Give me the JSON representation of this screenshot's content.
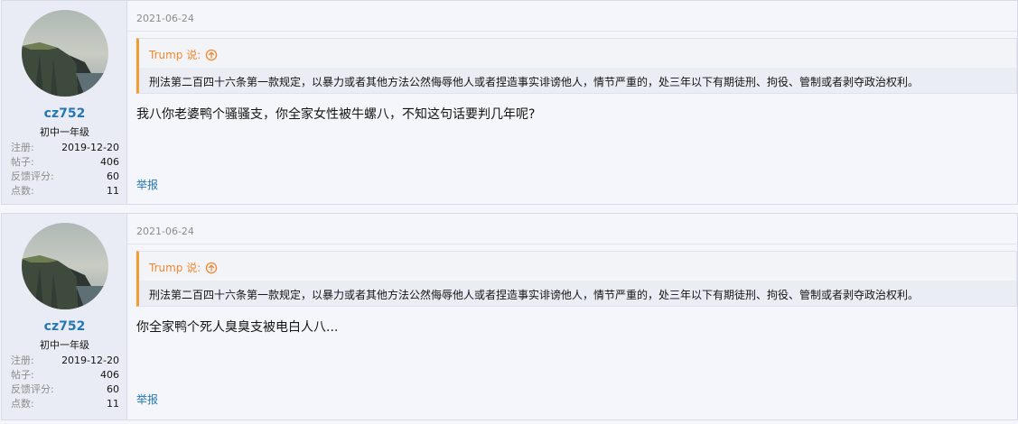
{
  "posts": [
    {
      "user": {
        "name": "cz752",
        "title": "初中一年级",
        "stats": [
          {
            "key": "注册:",
            "value": "2019-12-20"
          },
          {
            "key": "帖子:",
            "value": "406"
          },
          {
            "key": "反馈评分:",
            "value": "60"
          },
          {
            "key": "点数:",
            "value": "11"
          }
        ]
      },
      "date": "2021-06-24",
      "quote": {
        "author": "Trump 说:",
        "text": "刑法第二百四十六条第一款规定，以暴力或者其他方法公然侮辱他人或者捏造事实诽谤他人，情节严重的，处三年以下有期徒刑、拘役、管制或者剥夺政治权利。"
      },
      "content": "我八你老婆鸭个骚骚支，你全家女性被牛螺八，不知这句话要判几年呢?",
      "report_label": "举报"
    },
    {
      "user": {
        "name": "cz752",
        "title": "初中一年级",
        "stats": [
          {
            "key": "注册:",
            "value": "2019-12-20"
          },
          {
            "key": "帖子:",
            "value": "406"
          },
          {
            "key": "反馈评分:",
            "value": "60"
          },
          {
            "key": "点数:",
            "value": "11"
          }
        ]
      },
      "date": "2021-06-24",
      "quote": {
        "author": "Trump 说:",
        "text": "刑法第二百四十六条第一款规定，以暴力或者其他方法公然侮辱他人或者捏造事实诽谤他人，情节严重的，处三年以下有期徒刑、拘役、管制或者剥夺政治权利。"
      },
      "content": "你全家鸭个死人臭臭支被电白人八...",
      "report_label": "举报"
    }
  ],
  "icons": {
    "quote_jump": "arrow-up-circle-icon",
    "avatar": "cliff-landscape-avatar"
  },
  "colors": {
    "link": "#2577b1",
    "quote_accent": "#f39c30",
    "quote_author": "#f3872f",
    "muted": "#8c8c8c",
    "user_pane": "#e9ecf5"
  }
}
